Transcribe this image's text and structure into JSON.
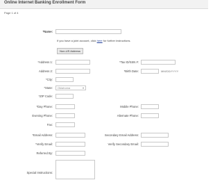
{
  "header": {
    "title": "Online Internet Banking Enrollment Form"
  },
  "pager": {
    "label": "Page 1 of 4"
  },
  "fields": {
    "name": "*Name:",
    "note_before": "If you have a joint account, click",
    "note_link": "here",
    "note_after": "for further instructions.",
    "non_us_button": "Non-US Address",
    "address1": "*Address 1:",
    "address2": "Address 2:",
    "city": "*City:",
    "state": "*State:",
    "state_value": "Oklahoma",
    "zip": "*ZIP Code:",
    "tax_id": "*Tax ID/SSN #:",
    "birth_date": "*Birth Date:",
    "birth_placeholder": "MM/DD/YYYY",
    "day_phone": "*Day Phone:",
    "evening_phone": "Evening Phone:",
    "fax": "Fax:",
    "mobile_phone": "Mobile Phone:",
    "alternate_phone": "Alternate Phone:",
    "email": "*Email Address:",
    "verify_email": "*Verify Email:",
    "secondary_email": "Secondary Email Address:",
    "verify_secondary_email": "Verify Secondary Email:",
    "referred_by": "Referred By:",
    "special_instructions": "Special Instructions:"
  }
}
